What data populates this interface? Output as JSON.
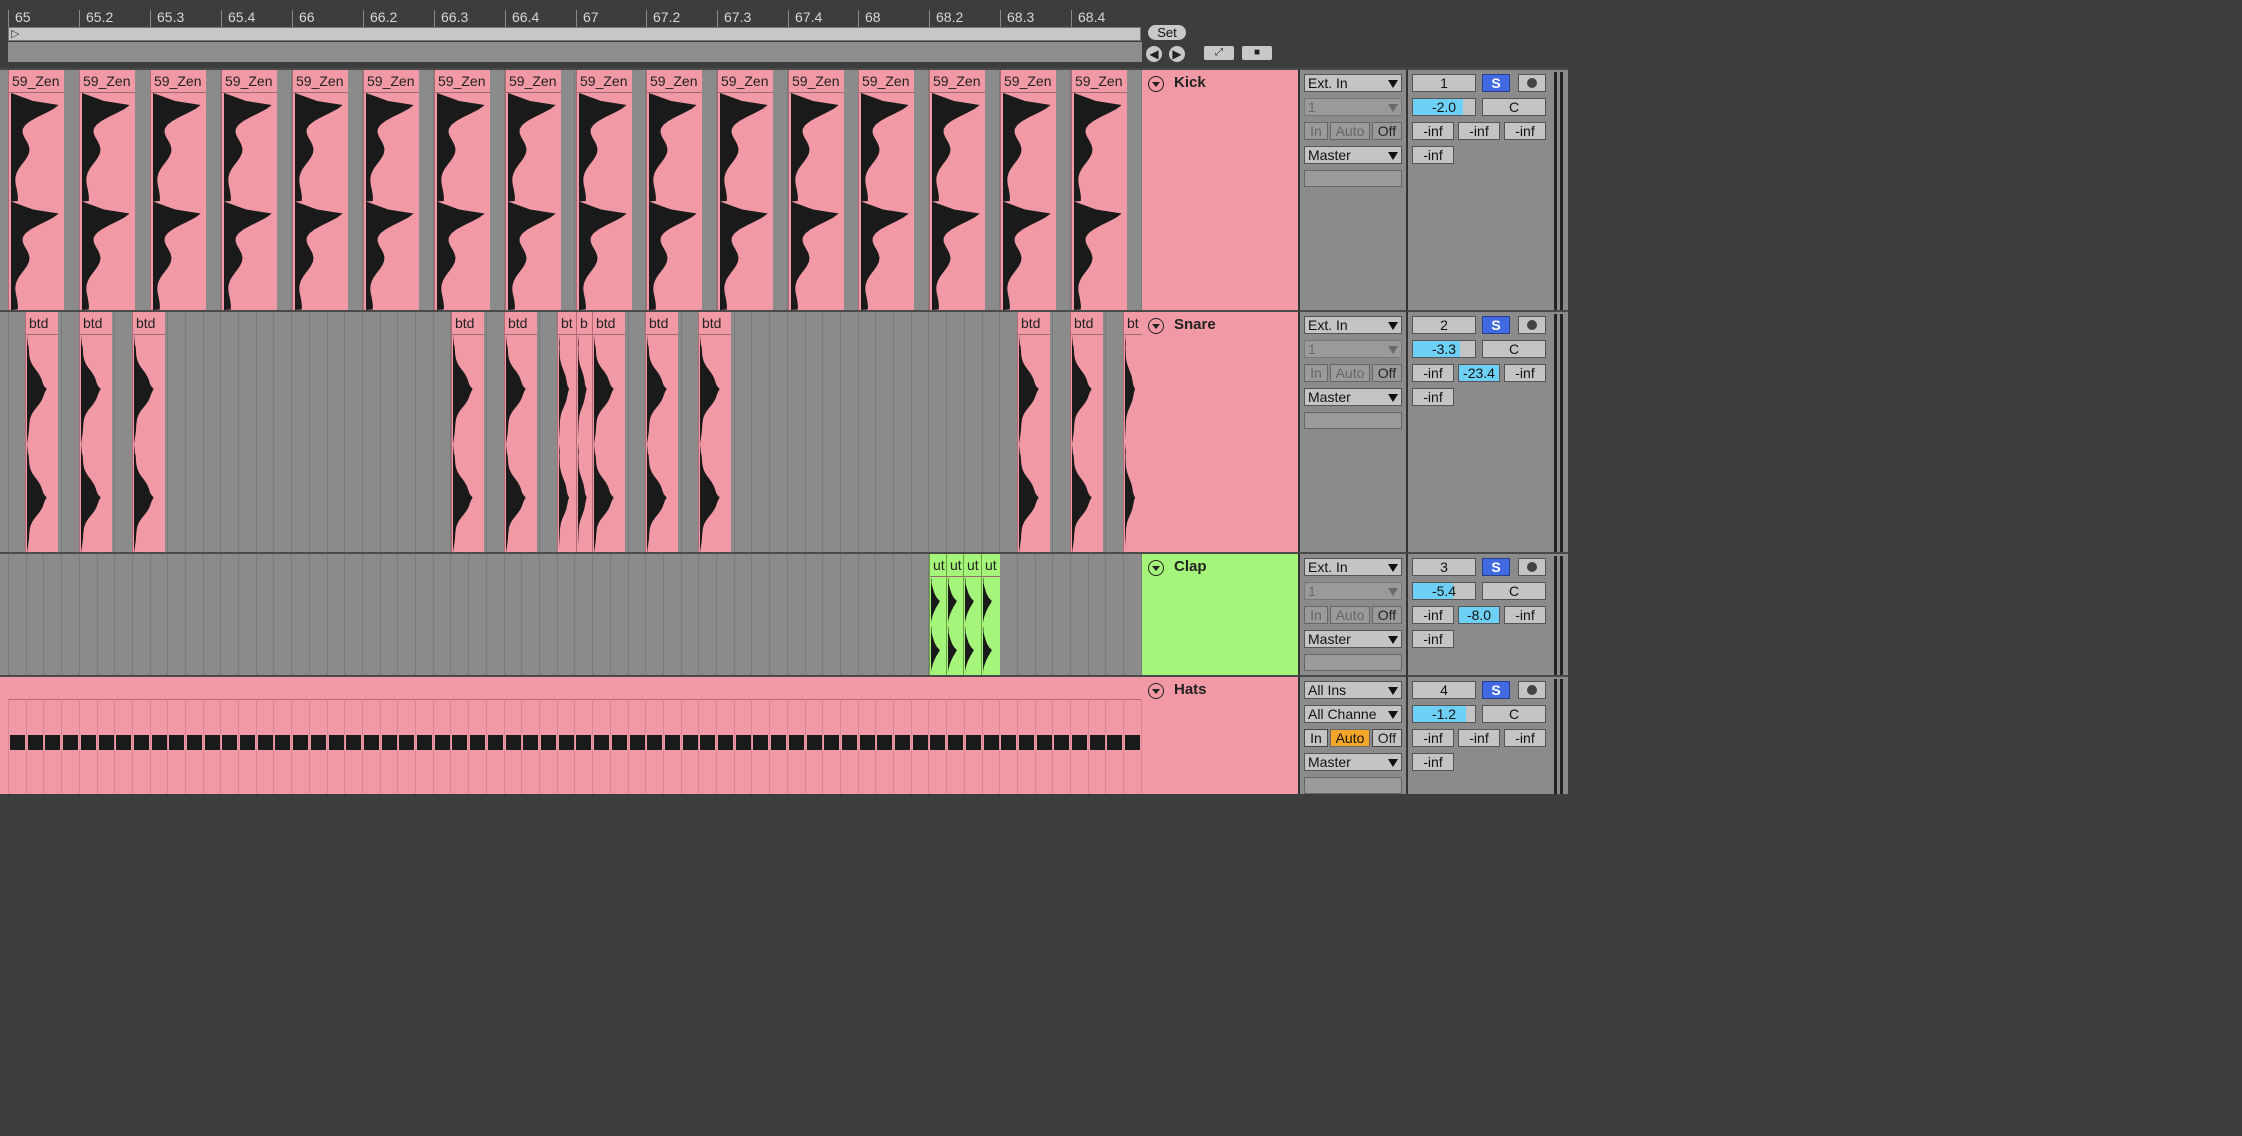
{
  "ruler": {
    "labels": [
      "65",
      "65.2",
      "65.3",
      "65.4",
      "66",
      "66.2",
      "66.3",
      "66.4",
      "67",
      "67.2",
      "67.3",
      "67.4",
      "68",
      "68.2",
      "68.3",
      "68.4"
    ]
  },
  "transport": {
    "set_label": "Set",
    "prev_locator_icon": "arrow-left-icon",
    "next_locator_icon": "arrow-right-icon",
    "expand_icon": "expand-icon",
    "lock_icon": "lock-icon"
  },
  "tracks": [
    {
      "name": "Kick",
      "color": "#f19aa5",
      "clip_label": "59_Zen",
      "clip_count": 16,
      "input_type": "Ext. In",
      "input_channel": "1",
      "monitor": {
        "in": "In",
        "auto": "Auto",
        "off": "Off",
        "active": "none"
      },
      "output": "Master",
      "number": "1",
      "solo": "S",
      "volume": "-2.0",
      "volume_fraction": 0.8,
      "pan": "C",
      "sends": [
        "-inf",
        "-inf",
        "-inf"
      ],
      "send_highlight": [],
      "peak": "-inf"
    },
    {
      "name": "Snare",
      "color": "#f19aa5",
      "clip_labels": [
        "btd",
        "btd",
        "btd",
        "btd",
        "btd",
        "bt",
        "b",
        "btd",
        "btd",
        "btd",
        "btd",
        "btd",
        "bt"
      ],
      "input_type": "Ext. In",
      "input_channel": "1",
      "monitor": {
        "in": "In",
        "auto": "Auto",
        "off": "Off",
        "active": "none"
      },
      "output": "Master",
      "number": "2",
      "solo": "S",
      "volume": "-3.3",
      "volume_fraction": 0.75,
      "pan": "C",
      "sends": [
        "-inf",
        "-23.4",
        "-inf"
      ],
      "send_highlight": [
        1
      ],
      "peak": "-inf"
    },
    {
      "name": "Clap",
      "color": "#a5f57a",
      "clip_labels": [
        "ut",
        "ut",
        "ut",
        "ut"
      ],
      "input_type": "Ext. In",
      "input_channel": "1",
      "monitor": {
        "in": "In",
        "auto": "Auto",
        "off": "Off",
        "active": "none"
      },
      "output": "Master",
      "number": "3",
      "solo": "S",
      "volume": "-5.4",
      "volume_fraction": 0.65,
      "pan": "C",
      "sends": [
        "-inf",
        "-8.0",
        "-inf"
      ],
      "send_highlight": [
        1
      ],
      "peak": "-inf"
    },
    {
      "name": "Hats",
      "color": "#f19aa5",
      "input_type": "All Ins",
      "input_channel": "All Channe",
      "monitor": {
        "in": "In",
        "auto": "Auto",
        "off": "Off",
        "active": "auto"
      },
      "output": "Master",
      "number": "4",
      "solo": "S",
      "volume": "-1.2",
      "volume_fraction": 0.85,
      "pan": "C",
      "sends": [
        "-inf",
        "-inf",
        "-inf"
      ],
      "send_highlight": [],
      "peak": "-inf"
    }
  ]
}
